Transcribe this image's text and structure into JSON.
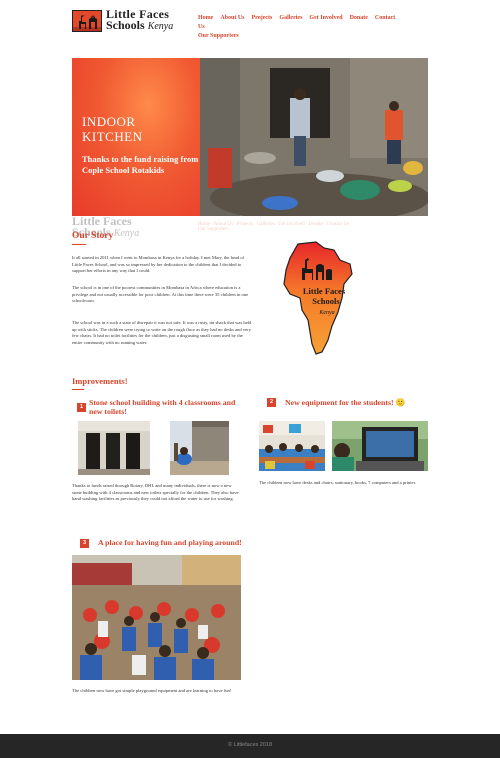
{
  "header": {
    "logo_line1": "Little Faces",
    "logo_line2": "Schools",
    "logo_country": "Kenya",
    "nav": [
      "Home",
      "About Us",
      "Projects",
      "Galleries",
      "Get Involved",
      "Donate",
      "Contact Us",
      "Our Supporters"
    ]
  },
  "hero": {
    "title_line1": "INDOOR",
    "title_line2": "KITCHEN",
    "subtitle": "Thanks to the fund raising from Cople School Rotakids"
  },
  "story": {
    "heading": "Our Story",
    "paragraphs": [
      "It all started in 2011 when I went to Mombasa in Kenya for a holiday. I met Mary, the head of Little Faces School, and was so impressed by her dedication to the children that I decided to support her efforts in any way that I could.",
      "The school is in one of the poorest communities in Mombasa in Africa where education is a privilege and not usually accessible for poor children. At this time there were 35 children in one schoolroom.",
      "The school was in a such a state of disrepair it was not safe. It was a rusty, tin shack that was held up with sticks. The children were trying to write on the rough floor as they had no desks and very few chairs. It had no toilet facilities for the children, just a disgusting small room used by the entire community with no running water."
    ],
    "map_label_1": "Little Faces",
    "map_label_2": "Schools",
    "map_label_3": "Kenya"
  },
  "improvements": {
    "heading": "Improvements!",
    "items": [
      {
        "number": "1",
        "title": "Stone school building with 4 classrooms and new toilets!",
        "caption": "Thanks to funds raised through Rotary, DHL and many individuals, there is now a new stone building with 4 classrooms and new toilets specially for the children. They also have hand washing facilities as previously they could not afford the water to use for washing."
      },
      {
        "number": "2",
        "title": "New equipment for the students! 🙂",
        "caption": "The children now have desks and chairs, stationary, books, 7 computers and a printer."
      },
      {
        "number": "3",
        "title": "A place for having fun and playing around!",
        "caption": "The children now have got simple playground equipment and are learning to have fun!"
      }
    ]
  },
  "footer": {
    "text": "© Littlefaces 2018"
  },
  "colors": {
    "accent": "#d8452c",
    "footer_bg": "#262626"
  }
}
